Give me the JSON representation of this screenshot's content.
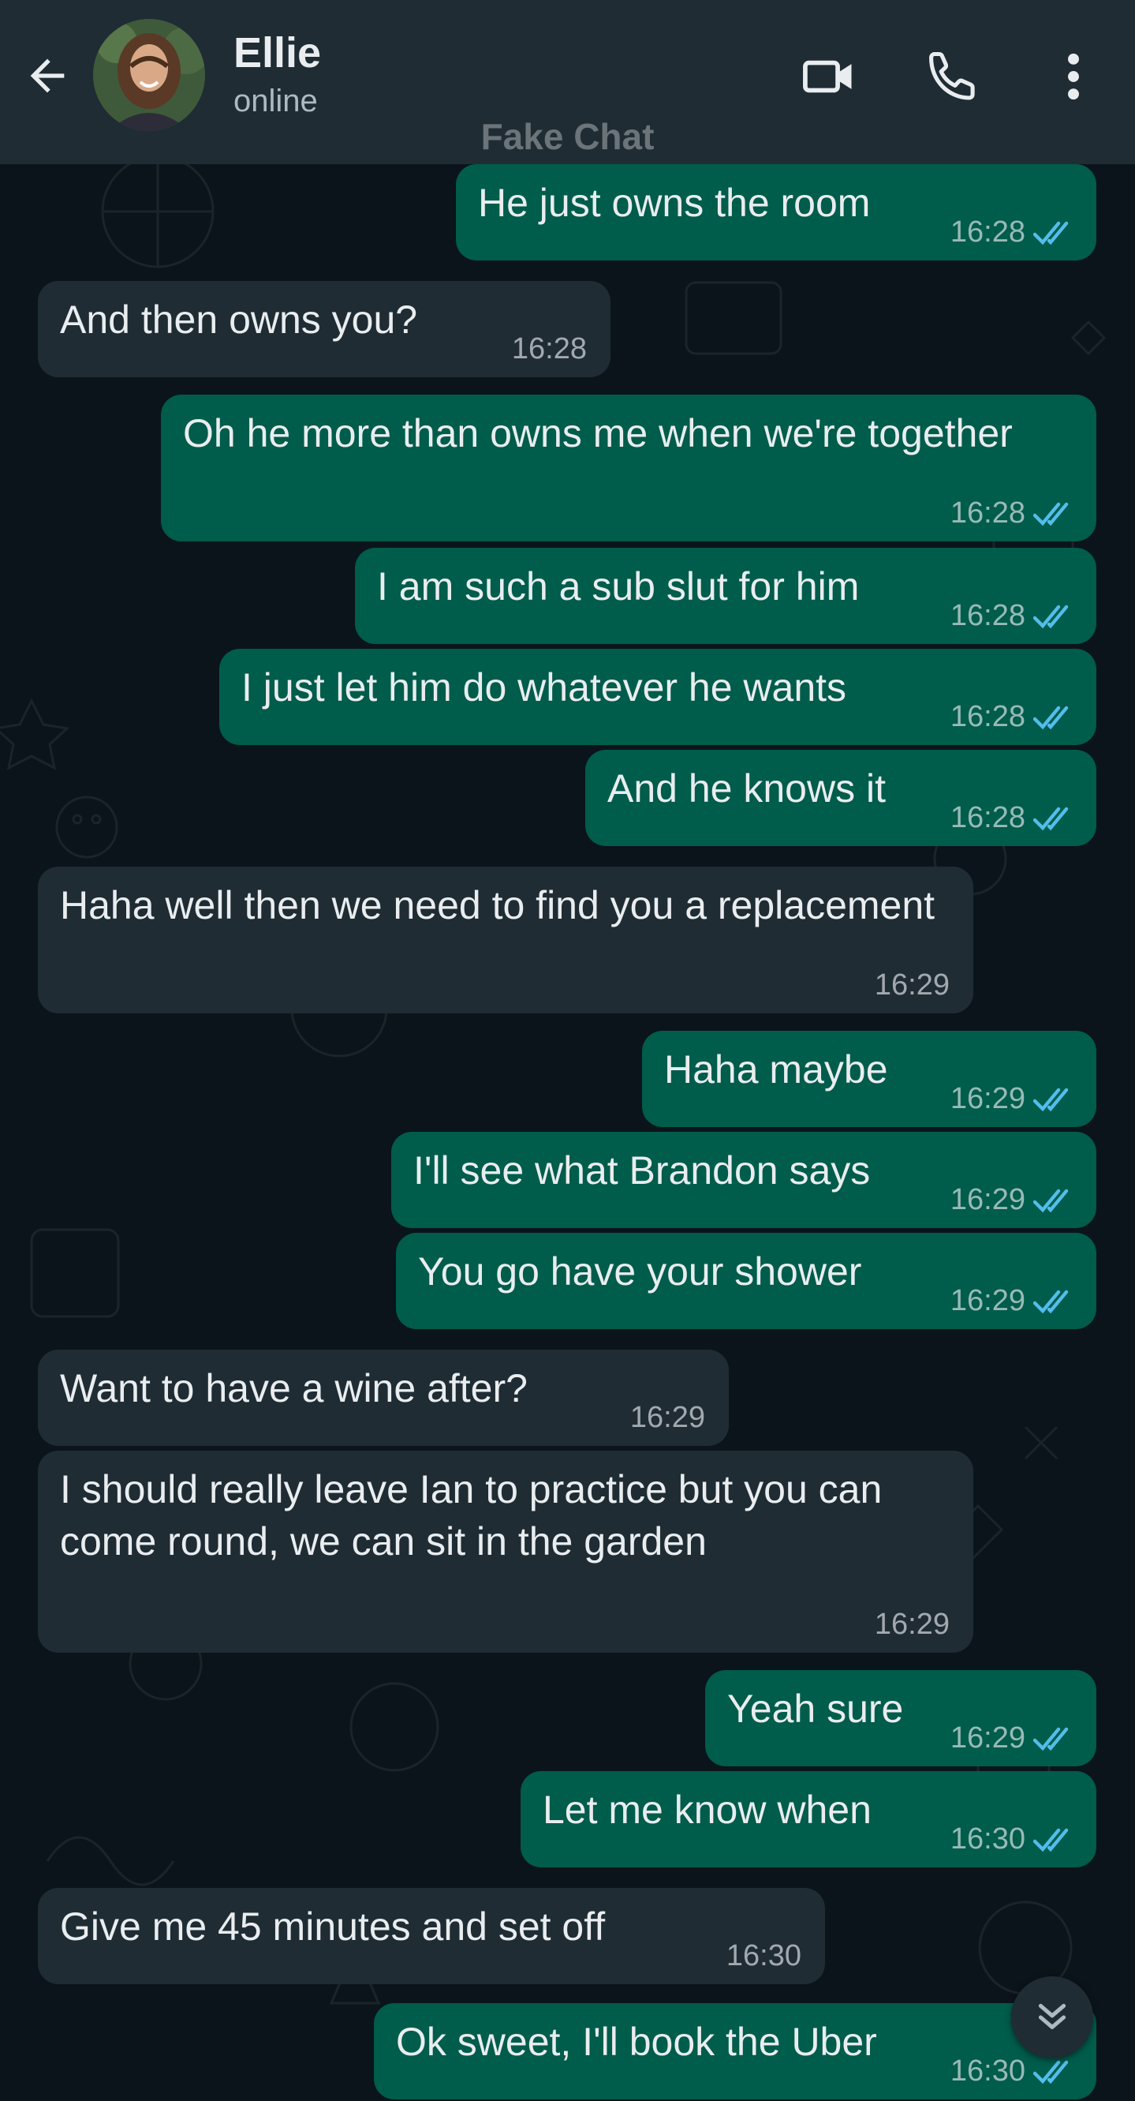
{
  "header": {
    "contact_name": "Ellie",
    "status": "online",
    "watermark": "Fake Chat",
    "icons": {
      "back": "arrow-back-icon",
      "video": "video-call-icon",
      "call": "phone-icon",
      "menu": "more-vertical-icon"
    }
  },
  "colors": {
    "header_bg": "#1f2c34",
    "chat_bg": "#0b141a",
    "outgoing_bubble": "#005c4b",
    "incoming_bubble": "#1f2c34",
    "read_tick": "#53bdeb"
  },
  "messages": [
    {
      "direction": "out",
      "text": "He just owns the room",
      "time": "16:28",
      "read": true
    },
    {
      "direction": "in",
      "text": "And then owns you?",
      "time": "16:28"
    },
    {
      "direction": "out",
      "text": "Oh he more than owns me when we're together",
      "time": "16:28",
      "read": true
    },
    {
      "direction": "out",
      "text": "I am such a sub slut for him",
      "time": "16:28",
      "read": true
    },
    {
      "direction": "out",
      "text": "I just let him do whatever he wants",
      "time": "16:28",
      "read": true
    },
    {
      "direction": "out",
      "text": "And he knows it",
      "time": "16:28",
      "read": true
    },
    {
      "direction": "in",
      "text": "Haha well then we need to find you a replacement",
      "time": "16:29"
    },
    {
      "direction": "out",
      "text": "Haha maybe",
      "time": "16:29",
      "read": true
    },
    {
      "direction": "out",
      "text": "I'll see what Brandon says",
      "time": "16:29",
      "read": true
    },
    {
      "direction": "out",
      "text": "You go have your shower",
      "time": "16:29",
      "read": true
    },
    {
      "direction": "in",
      "text": "Want to have a wine after?",
      "time": "16:29"
    },
    {
      "direction": "in",
      "text": "I should really leave Ian to practice but you can come round, we can sit in the garden",
      "time": "16:29"
    },
    {
      "direction": "out",
      "text": "Yeah sure",
      "time": "16:29",
      "read": true
    },
    {
      "direction": "out",
      "text": "Let me know when",
      "time": "16:30",
      "read": true
    },
    {
      "direction": "in",
      "text": "Give me 45 minutes and set off",
      "time": "16:30"
    },
    {
      "direction": "out",
      "text": "Ok sweet, I'll book the Uber",
      "time": "16:30",
      "read": true
    }
  ],
  "scroll_button_icon": "double-chevron-down-icon"
}
